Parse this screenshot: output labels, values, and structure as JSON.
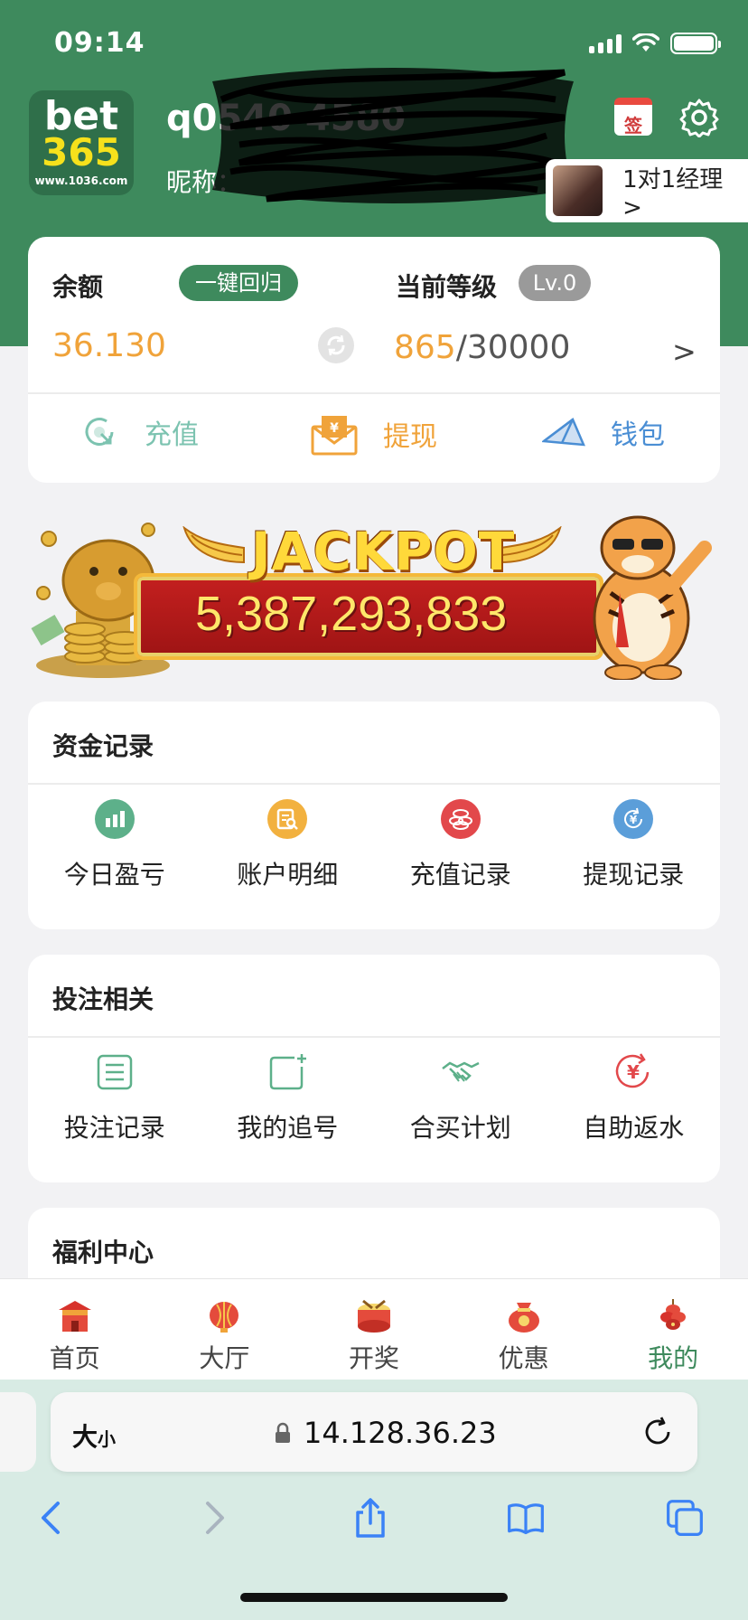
{
  "status_bar": {
    "time": "09:14"
  },
  "header": {
    "logo_text_1": "bet",
    "logo_text_2": "365",
    "logo_url": "www.1036.com",
    "username": "q0540 4580",
    "nickname_label": "昵称：",
    "sign_label": "签",
    "manager_label": "1对1经理 >"
  },
  "balance": {
    "label": "余额",
    "recall_button": "一键回归",
    "value": "36.130",
    "level_label": "当前等级",
    "level_badge": "Lv.0",
    "level_current": "865",
    "level_total": "/30000",
    "arrow": ">"
  },
  "actions": [
    {
      "label": "充值",
      "icon": "recharge-icon"
    },
    {
      "label": "提现",
      "icon": "withdraw-envelope-icon"
    },
    {
      "label": "钱包",
      "icon": "wallet-plane-icon"
    }
  ],
  "jackpot": {
    "title": "JACKPOT",
    "amount": "5,387,293,833"
  },
  "funds_section": {
    "title": "资金记录",
    "items": [
      {
        "label": "今日盈亏",
        "icon": "bar-chart-icon",
        "color": "#5db08a"
      },
      {
        "label": "账户明细",
        "icon": "document-search-icon",
        "color": "#f2b13f"
      },
      {
        "label": "充值记录",
        "icon": "coins-icon",
        "color": "#e2484b"
      },
      {
        "label": "提现记录",
        "icon": "yen-cycle-icon",
        "color": "#5b9ed9"
      }
    ]
  },
  "betting_section": {
    "title": "投注相关",
    "items": [
      {
        "label": "投注记录",
        "icon": "list-icon"
      },
      {
        "label": "我的追号",
        "icon": "add-square-icon"
      },
      {
        "label": "合买计划",
        "icon": "handshake-icon"
      },
      {
        "label": "自助返水",
        "icon": "yen-return-icon"
      }
    ]
  },
  "welfare_section": {
    "title": "福利中心"
  },
  "tabbar": [
    {
      "label": "首页",
      "icon": "home-temple-icon",
      "active": false
    },
    {
      "label": "大厅",
      "icon": "lantern-icon",
      "active": false
    },
    {
      "label": "开奖",
      "icon": "drum-icon",
      "active": false
    },
    {
      "label": "优惠",
      "icon": "lucky-bag-icon",
      "active": false
    },
    {
      "label": "我的",
      "icon": "firecracker-icon",
      "active": true
    }
  ],
  "browser": {
    "text_size_label": "大",
    "text_size_small": "小",
    "url": "14.128.36.23"
  },
  "colors": {
    "brand_green": "#3e8a5d",
    "accent_orange": "#f0a33a",
    "wallet_blue": "#4a8ed4"
  }
}
